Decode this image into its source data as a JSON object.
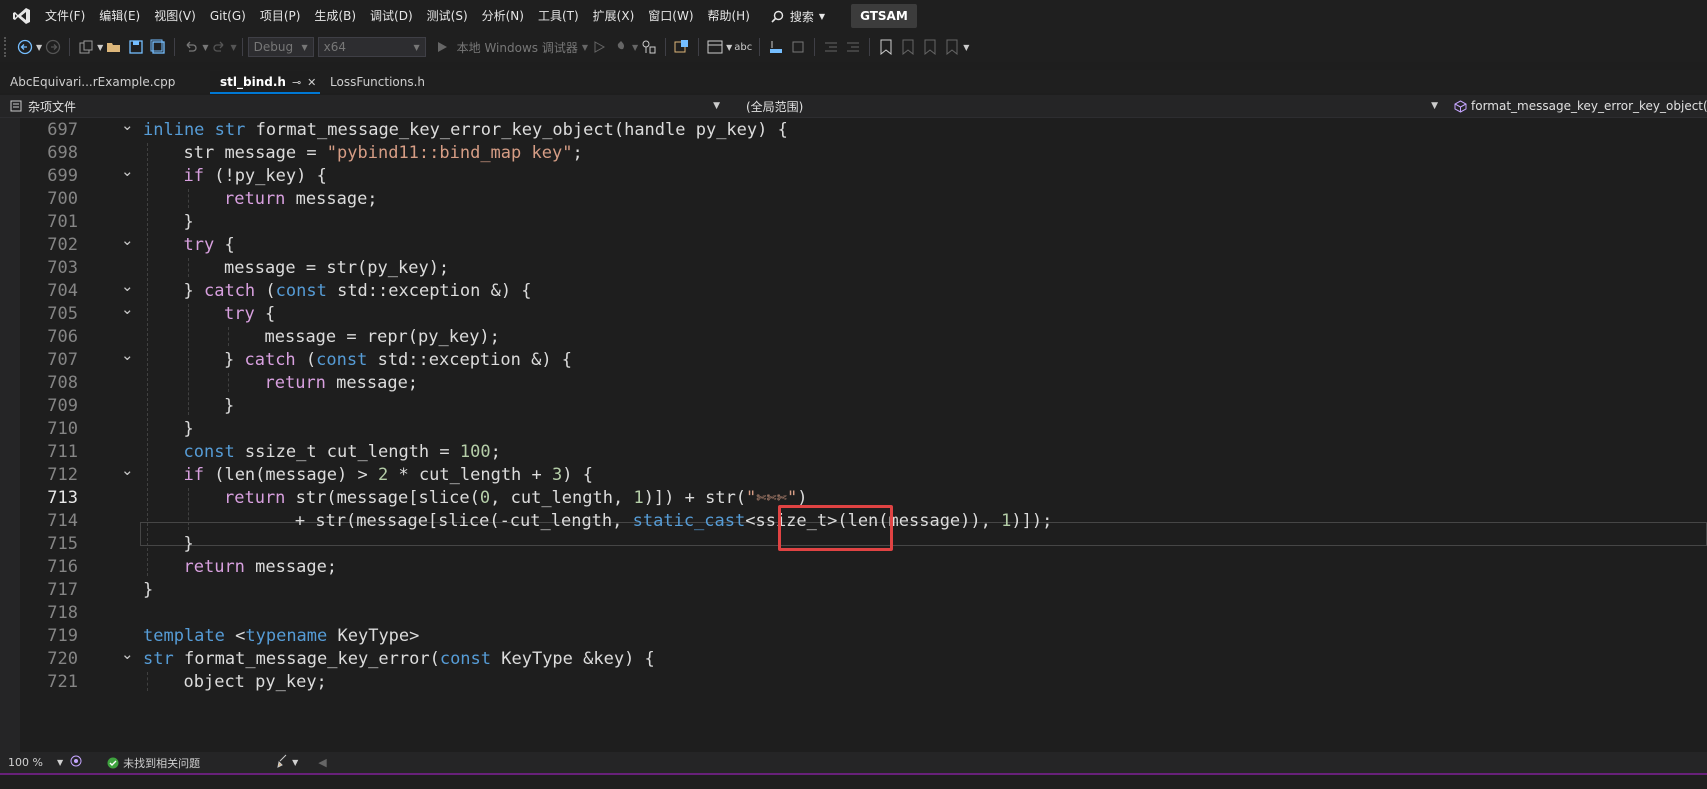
{
  "menu": {
    "items": [
      "文件(F)",
      "编辑(E)",
      "视图(V)",
      "Git(G)",
      "项目(P)",
      "生成(B)",
      "调试(D)",
      "测试(S)",
      "分析(N)",
      "工具(T)",
      "扩展(X)",
      "窗口(W)",
      "帮助(H)"
    ],
    "search_label": "搜索",
    "solution_name": "GTSAM"
  },
  "toolbar": {
    "config": "Debug",
    "platform": "x64",
    "debug_target": "本地 Windows 调试器"
  },
  "tabs": [
    {
      "label": "AbcEquivari...rExample.cpp",
      "active": false
    },
    {
      "label": "stl_bind.h",
      "active": true
    },
    {
      "label": "LossFunctions.h",
      "active": false
    }
  ],
  "navbar": {
    "project": "杂项文件",
    "scope": "(全局范围)",
    "member": "format_message_key_error_key_object(ha"
  },
  "editor": {
    "current_line": 713,
    "lines": [
      {
        "n": 697,
        "fold": true,
        "indent": 0,
        "html": "<span class=\"kw\">inline</span> <span class=\"kw\">str</span> format_message_key_error_key_object(handle py_key) {"
      },
      {
        "n": 698,
        "fold": false,
        "indent": 1,
        "html": "str message = <span class=\"str\">\"pybind11::bind_map key\"</span>;"
      },
      {
        "n": 699,
        "fold": true,
        "indent": 1,
        "html": "<span class=\"kc\">if</span> (!py_key) {"
      },
      {
        "n": 700,
        "fold": false,
        "indent": 2,
        "html": "<span class=\"kc\">return</span> message;"
      },
      {
        "n": 701,
        "fold": false,
        "indent": 1,
        "html": "}"
      },
      {
        "n": 702,
        "fold": true,
        "indent": 1,
        "html": "<span class=\"kc\">try</span> {"
      },
      {
        "n": 703,
        "fold": false,
        "indent": 2,
        "html": "message = str(py_key);"
      },
      {
        "n": 704,
        "fold": true,
        "indent": 1,
        "html": "} <span class=\"kc\">catch</span> (<span class=\"kw\">const</span> std::exception &amp;) {"
      },
      {
        "n": 705,
        "fold": true,
        "indent": 2,
        "html": "<span class=\"kc\">try</span> {"
      },
      {
        "n": 706,
        "fold": false,
        "indent": 3,
        "html": "message = repr(py_key);"
      },
      {
        "n": 707,
        "fold": true,
        "indent": 2,
        "html": "} <span class=\"kc\">catch</span> (<span class=\"kw\">const</span> std::exception &amp;) {"
      },
      {
        "n": 708,
        "fold": false,
        "indent": 3,
        "html": "<span class=\"kc\">return</span> message;"
      },
      {
        "n": 709,
        "fold": false,
        "indent": 2,
        "html": "}"
      },
      {
        "n": 710,
        "fold": false,
        "indent": 1,
        "html": "}"
      },
      {
        "n": 711,
        "fold": false,
        "indent": 1,
        "html": "<span class=\"kw\">const</span> ssize_t cut_length = <span class=\"num\">100</span>;"
      },
      {
        "n": 712,
        "fold": true,
        "indent": 1,
        "html": "<span class=\"kc\">if</span> (len(message) &gt; <span class=\"num\">2</span> * cut_length + <span class=\"num\">3</span>) {"
      },
      {
        "n": 713,
        "fold": false,
        "indent": 2,
        "html": "<span class=\"kc\">return</span> str(message[slice(<span class=\"num\">0</span>, cut_length, <span class=\"num\">1</span>)]) + str(<span class=\"str\">\"✄✄✄\"</span>)"
      },
      {
        "n": 714,
        "fold": false,
        "indent": 2,
        "extra": 7,
        "html": "+ str(message[slice(-cut_length, <span class=\"kw\">static_cast</span>&lt;ssize_t&gt;(len(message)), <span class=\"num\">1</span>)]);"
      },
      {
        "n": 715,
        "fold": false,
        "indent": 1,
        "html": "}"
      },
      {
        "n": 716,
        "fold": false,
        "indent": 1,
        "html": "<span class=\"kc\">return</span> message;"
      },
      {
        "n": 717,
        "fold": false,
        "indent": 0,
        "html": "}"
      },
      {
        "n": 718,
        "fold": false,
        "indent": 0,
        "html": ""
      },
      {
        "n": 719,
        "fold": false,
        "indent": 0,
        "html": "<span class=\"kw\">template</span> &lt;<span class=\"kw\">typename</span> KeyType&gt;"
      },
      {
        "n": 720,
        "fold": true,
        "indent": 0,
        "html": "<span class=\"kw\">str</span> format_message_key_error(<span class=\"kw\">const</span> KeyType &amp;key) {"
      },
      {
        "n": 721,
        "fold": false,
        "indent": 1,
        "html": "object py_key;"
      }
    ]
  },
  "status": {
    "zoom": "100 %",
    "issues": "未找到相关问题"
  }
}
